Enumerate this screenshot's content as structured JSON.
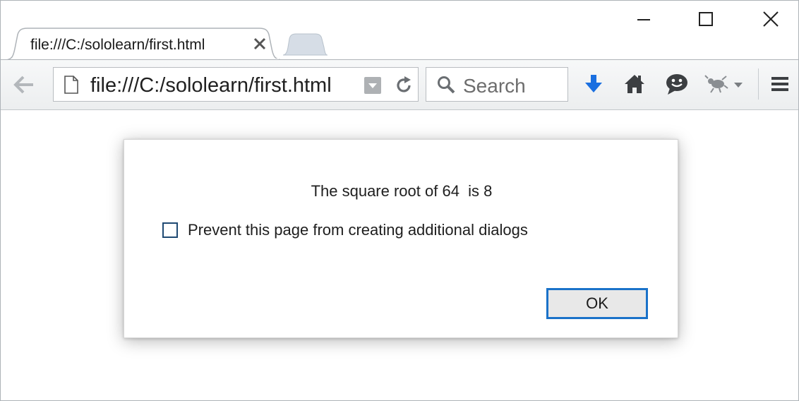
{
  "browser": {
    "tab": {
      "title": "file:///C:/sololearn/first.html"
    },
    "urlbar": {
      "value": "file:///C:/sololearn/first.html"
    },
    "searchbar": {
      "placeholder": "Search"
    },
    "toolbar_icons": [
      "back-arrow-icon",
      "page-icon",
      "dropmarker-icon",
      "reload-icon",
      "search-icon",
      "download-icon",
      "home-icon",
      "chat-icon",
      "bug-icon",
      "menu-icon"
    ],
    "window_controls": [
      "minimize-icon",
      "maximize-icon",
      "close-icon"
    ]
  },
  "dialog": {
    "message": "The square root of 64  is 8",
    "checkbox_label": "Prevent this page from creating additional dialogs",
    "checkbox_checked": false,
    "ok_label": "OK"
  },
  "colors": {
    "download_blue": "#1a6fe0",
    "focus_border": "#1a72c9",
    "checkbox_border": "#1f4a73"
  }
}
